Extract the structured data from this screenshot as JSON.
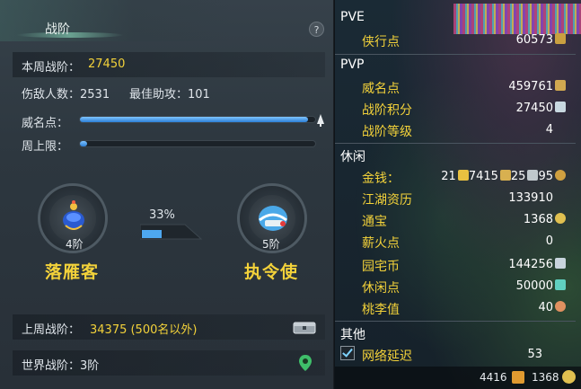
{
  "panel": {
    "tab_title": "战阶",
    "help_label": "?",
    "weekly_label": "本周战阶：",
    "weekly_value": "27450",
    "kills_label": "伤敌人数：2531",
    "assists_label": "最佳助攻：101",
    "prestige_label": "威名点：",
    "prestige_progress": 0.97,
    "weekly_cap_label": "周上限：",
    "weekly_cap_progress": 0.03,
    "percent_label": "33%",
    "percent_value": 0.33,
    "rank_left": {
      "level": "4阶",
      "name": "落雁客"
    },
    "rank_right": {
      "level": "5阶",
      "name": "执令使"
    },
    "last_week_label": "上周战阶：",
    "last_week_value": "34375 (500名以外)",
    "world_label": "世界战阶：3阶"
  },
  "stats": {
    "pve_header": "PVE",
    "pve_rows": [
      {
        "label": "侠行点",
        "value": "60573"
      }
    ],
    "pvp_header": "PVP",
    "pvp_rows": [
      {
        "label": "威名点",
        "value": "459761"
      },
      {
        "label": "战阶积分",
        "value": "27450"
      },
      {
        "label": "战阶等级",
        "value": "4"
      }
    ],
    "leisure_header": "休闲",
    "money_label": "金钱：",
    "money_gold": "21",
    "money_silver": "7415",
    "money_copper": "25",
    "money_other": "95",
    "leisure_rows": [
      {
        "label": "江湖资历",
        "value": "133910"
      },
      {
        "label": "通宝",
        "value": "1368"
      },
      {
        "label": "薪火点",
        "value": "0"
      },
      {
        "label": "园宅币",
        "value": "144256"
      },
      {
        "label": "休闲点",
        "value": "50000"
      },
      {
        "label": "桃李值",
        "value": "40"
      }
    ],
    "other_header": "其他",
    "latency_label": "网络延迟",
    "latency_value": "53",
    "bottom_left": "4416",
    "bottom_right": "1368"
  },
  "colors": {
    "accent_yellow": "#f3d23a",
    "bar_blue": "#2c7fd6"
  }
}
